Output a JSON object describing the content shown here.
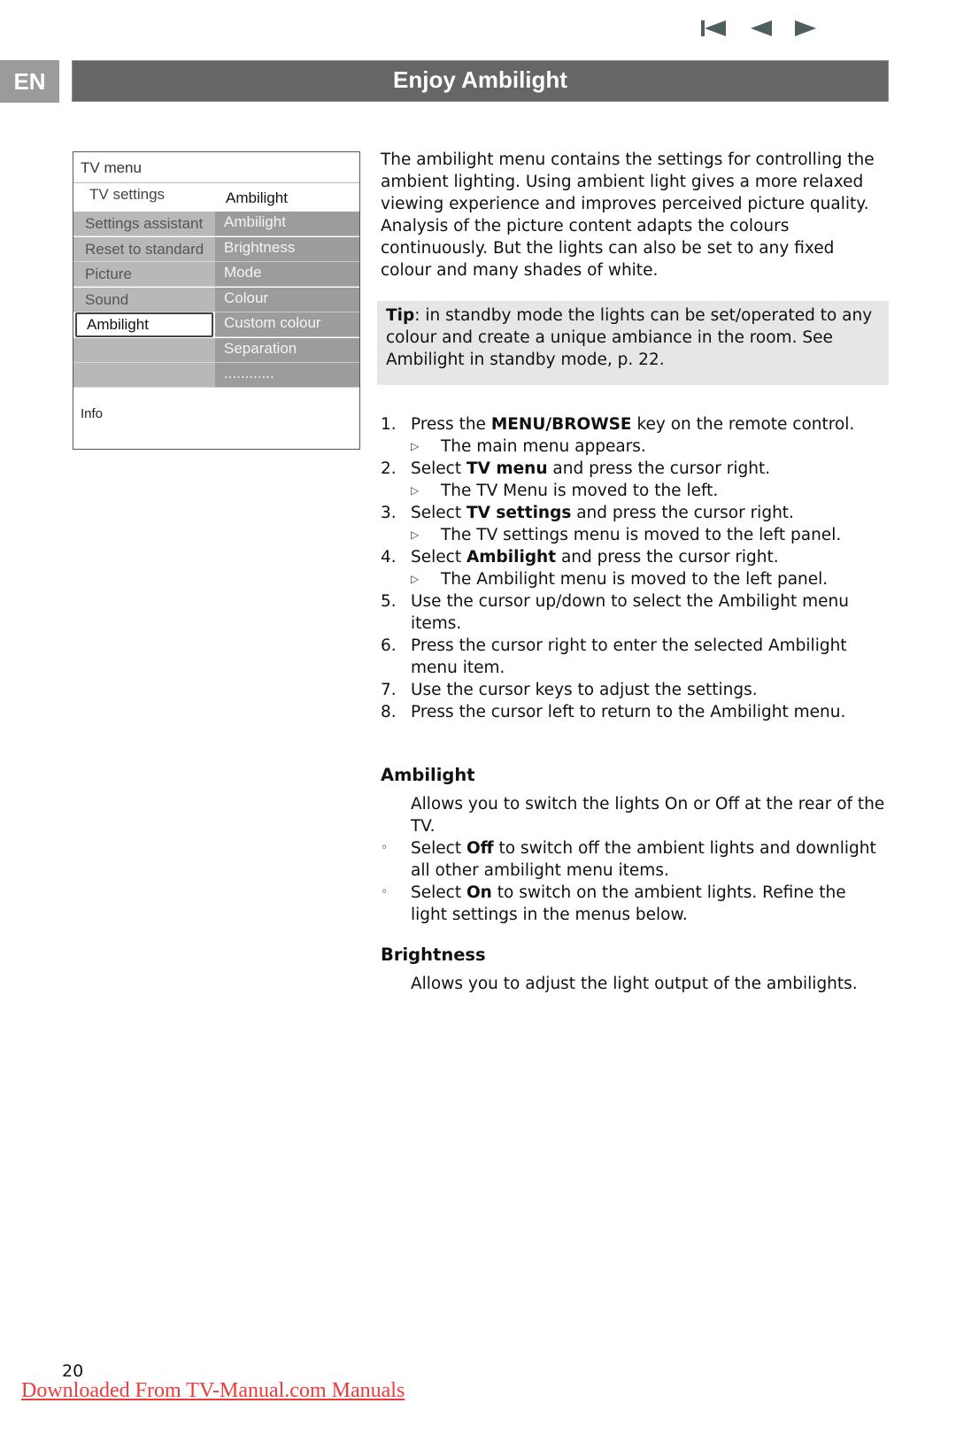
{
  "nav": {
    "first_icon": "skip-to-first-icon",
    "prev_icon": "previous-page-icon",
    "next_icon": "next-page-icon",
    "icon_color": "#4f5f5f"
  },
  "header": {
    "lang": "EN",
    "title": "Enjoy Ambilight"
  },
  "tv_menu": {
    "title": "TV menu",
    "breadcrumb_left": "TV settings",
    "breadcrumb_right": "Ambilight",
    "left_items": [
      "Settings assistant",
      "Reset to standard",
      "Picture",
      "Sound",
      "Ambilight",
      "",
      ""
    ],
    "selected_left_index": 4,
    "right_items": [
      "Ambilight",
      "Brightness",
      "Mode",
      "Colour",
      "Custom colour",
      "Separation",
      "............"
    ],
    "info_label": "Info"
  },
  "intro": "The ambilight menu contains the settings for controlling the ambient lighting. Using ambient light gives a more relaxed viewing experience and improves perceived picture quality. Analysis of the picture content adapts the colours continuously. But the lights can also be set to any fixed colour and many shades of white.",
  "tip": {
    "label": "Tip",
    "text": ": in standby mode the lights can be set/operated to any colour and create a unique ambiance in the room. See Ambilight in standby mode, p. 22."
  },
  "steps": [
    {
      "num": "1.",
      "pre": "Press the ",
      "bold": "MENU/BROWSE",
      "post": " key on the remote control.",
      "result": "The main menu appears."
    },
    {
      "num": "2.",
      "pre": "Select ",
      "bold": "TV menu",
      "post": " and press the cursor right.",
      "result": "The TV Menu is moved to the left."
    },
    {
      "num": "3.",
      "pre": "Select ",
      "bold": "TV settings",
      "post": " and press the cursor right.",
      "result": "The TV settings menu is moved to the left panel."
    },
    {
      "num": "4.",
      "pre": "Select ",
      "bold": "Ambilight",
      "post": " and press the cursor right.",
      "result": "The Ambilight menu is moved to the left panel."
    },
    {
      "num": "5.",
      "pre": "Use the cursor up/down to select the Ambilight menu items.",
      "bold": "",
      "post": "",
      "result": ""
    },
    {
      "num": "6.",
      "pre": "Press the cursor right to enter the selected Ambilight menu item.",
      "bold": "",
      "post": "",
      "result": ""
    },
    {
      "num": "7.",
      "pre": "Use the cursor keys to adjust the settings.",
      "bold": "",
      "post": "",
      "result": ""
    },
    {
      "num": "8.",
      "pre": "Press the cursor left to return to the Ambilight menu.",
      "bold": "",
      "post": "",
      "result": ""
    }
  ],
  "sections": {
    "ambilight": {
      "heading": "Ambilight",
      "desc": "Allows you to switch the lights On or Off at the rear of the TV.",
      "bullets": [
        {
          "pre": "Select ",
          "bold": "Off",
          "post": " to switch off the ambient lights and downlight all other ambilight menu items."
        },
        {
          "pre": "Select ",
          "bold": "On",
          "post": " to switch on the ambient lights. Refine the light settings in the menus below."
        }
      ]
    },
    "brightness": {
      "heading": "Brightness",
      "desc": "Allows you to adjust the light output of the ambilights."
    }
  },
  "footer": {
    "page_number": "20",
    "download_link": "Downloaded From TV-Manual.com Manuals",
    "link_color": "#ee3b3b"
  }
}
